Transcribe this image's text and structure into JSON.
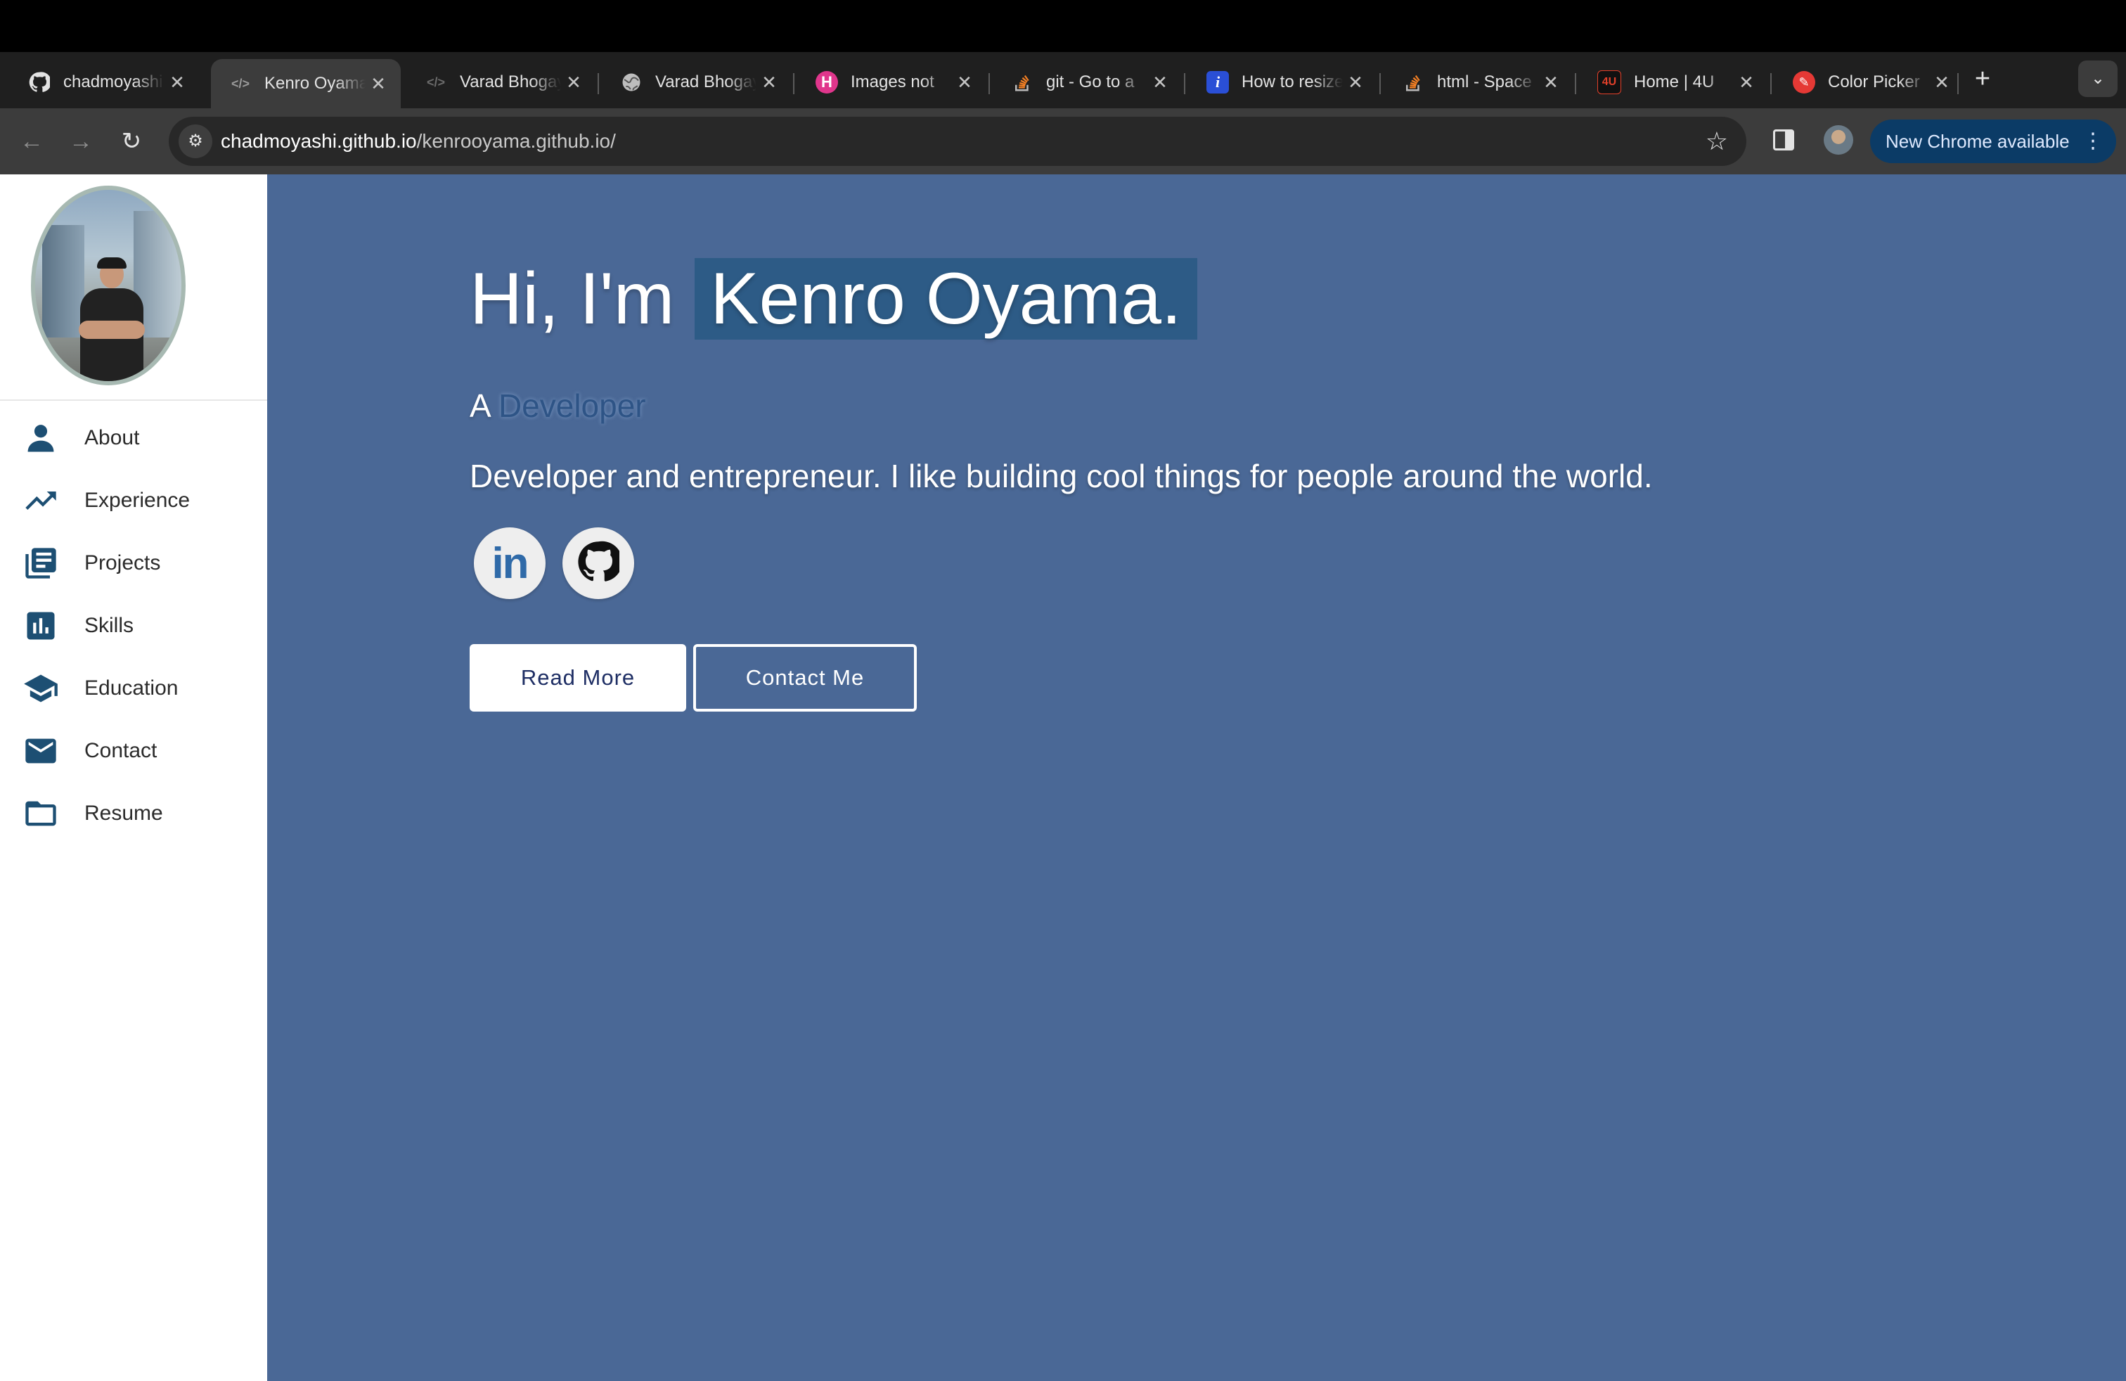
{
  "browser": {
    "tabs": [
      {
        "title": "chadmoyashi",
        "favicon": "github-icon",
        "active": false
      },
      {
        "title": "Kenro Oyama",
        "favicon": "code-icon",
        "active": true
      },
      {
        "title": "Varad Bhogayata",
        "favicon": "code-icon",
        "active": false
      },
      {
        "title": "Varad Bhogayata",
        "favicon": "globe-icon",
        "active": false
      },
      {
        "title": "Images not",
        "favicon": "hashnode-icon",
        "active": false
      },
      {
        "title": "git - Go to a",
        "favicon": "stackoverflow-icon",
        "active": false
      },
      {
        "title": "How to resize",
        "favicon": "info-icon",
        "active": false
      },
      {
        "title": "html - Space",
        "favicon": "stackoverflow-icon",
        "active": false
      },
      {
        "title": "Home | 4U",
        "favicon": "4u-icon",
        "active": false
      },
      {
        "title": "Color Picker",
        "favicon": "color-picker-icon",
        "active": false
      }
    ],
    "url_host": "chadmoyashi.github.io",
    "url_path": "/kenrooyama.github.io/",
    "update_label": "New Chrome available"
  },
  "sidebar": {
    "items": [
      {
        "label": "About",
        "icon": "person-icon"
      },
      {
        "label": "Experience",
        "icon": "trending-up-icon"
      },
      {
        "label": "Projects",
        "icon": "library-books-icon"
      },
      {
        "label": "Skills",
        "icon": "bar-chart-icon"
      },
      {
        "label": "Education",
        "icon": "school-icon"
      },
      {
        "label": "Contact",
        "icon": "mail-icon"
      },
      {
        "label": "Resume",
        "icon": "folder-icon"
      }
    ]
  },
  "hero": {
    "greeting": "Hi, I'm",
    "name": "Kenro Oyama.",
    "role_prefix": "A",
    "role_word": "Developer",
    "tagline": "Developer and entrepreneur. I like building cool things for people around the world.",
    "linkedin_text": "in",
    "read_more_label": "Read More",
    "contact_label": "Contact Me"
  },
  "colors": {
    "page_bg": "#4a6896",
    "name_highlight": "#2d5b86",
    "icon_color": "#1d4f73"
  }
}
